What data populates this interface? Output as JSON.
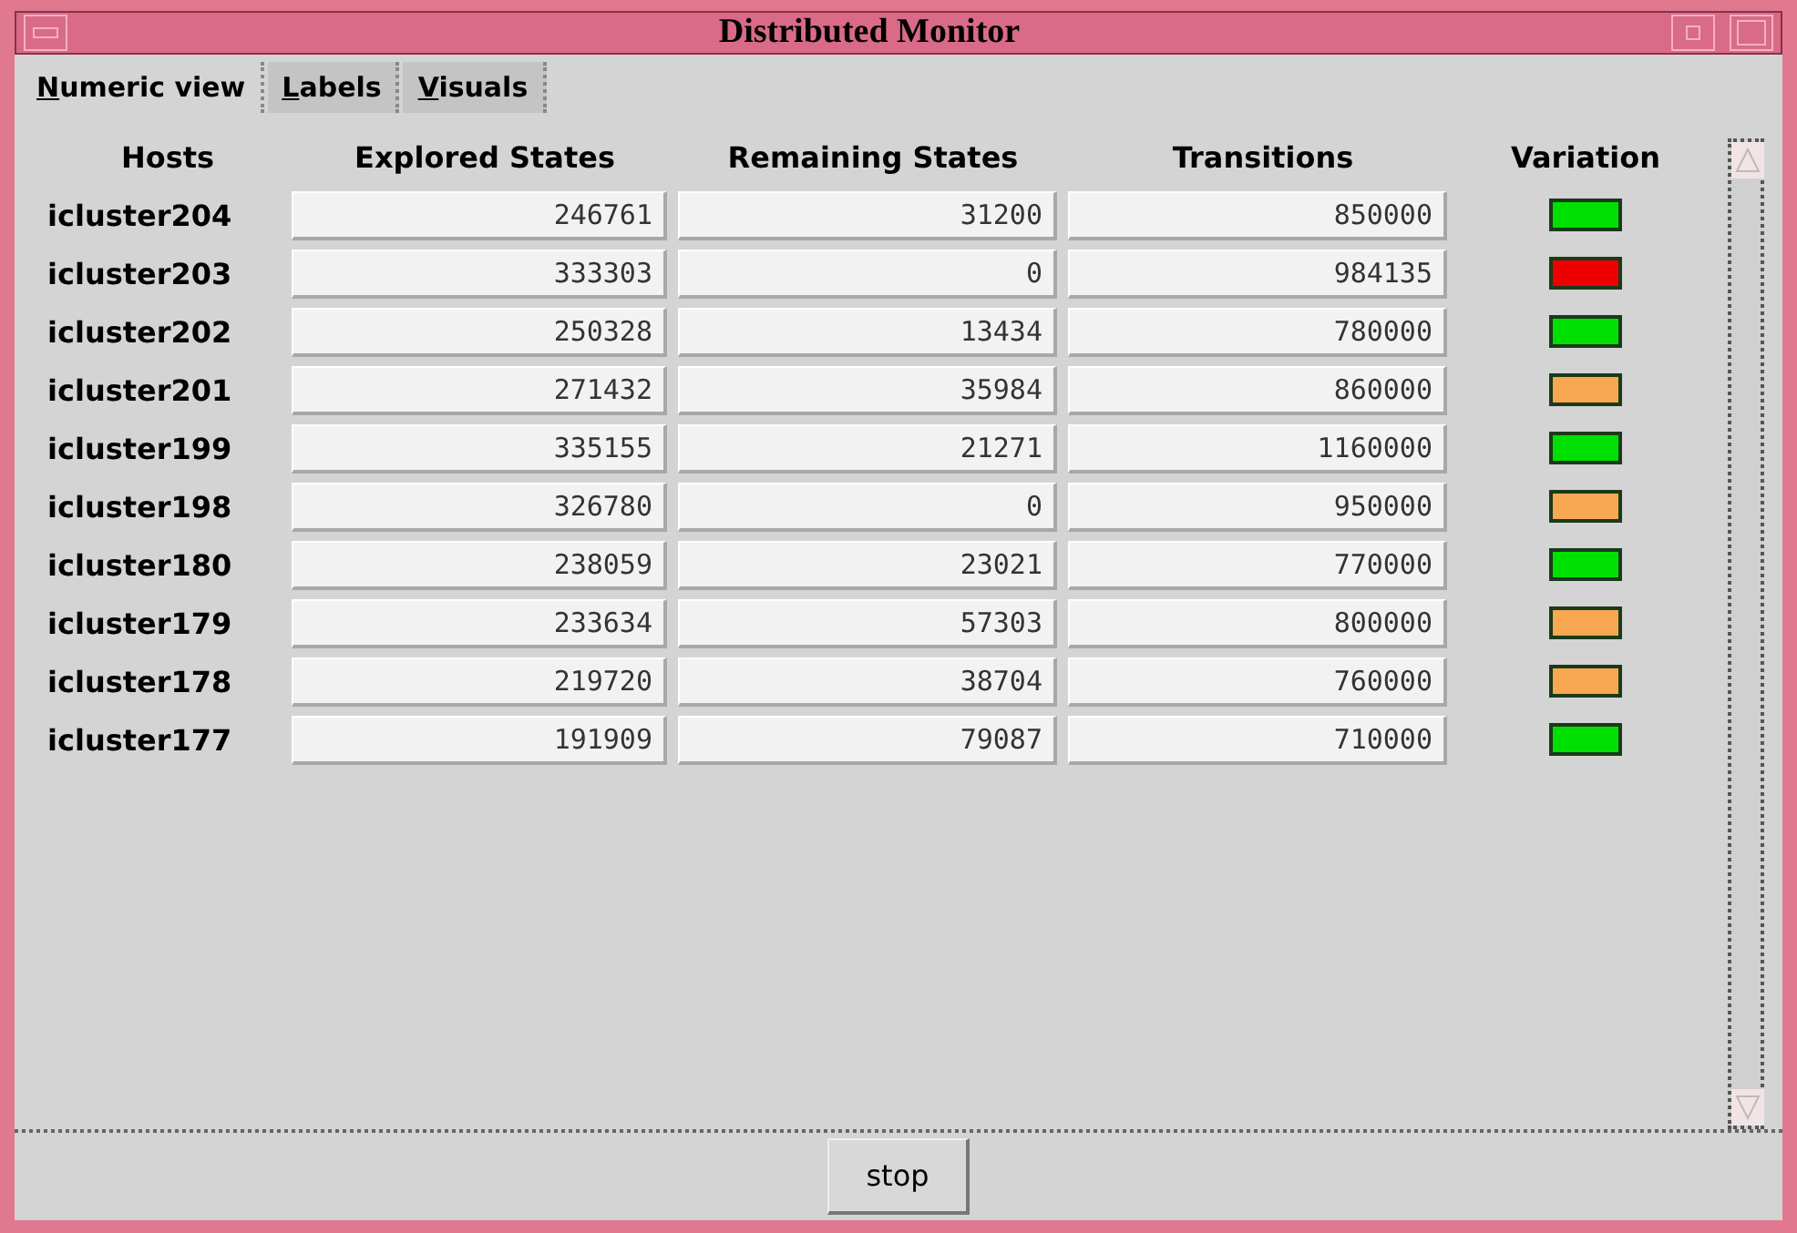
{
  "window": {
    "title": "Distributed Monitor"
  },
  "tabs": [
    {
      "label": "Numeric view",
      "selected": true
    },
    {
      "label": "Labels",
      "selected": false
    },
    {
      "label": "Visuals",
      "selected": false
    }
  ],
  "table": {
    "columns": [
      "Hosts",
      "Explored States",
      "Remaining States",
      "Transitions",
      "Variation"
    ],
    "rows": [
      {
        "host": "icluster204",
        "explored": "246761",
        "remaining": "31200",
        "transitions": "850000",
        "color": "#00e000"
      },
      {
        "host": "icluster203",
        "explored": "333303",
        "remaining": "0",
        "transitions": "984135",
        "color": "#ee0000"
      },
      {
        "host": "icluster202",
        "explored": "250328",
        "remaining": "13434",
        "transitions": "780000",
        "color": "#00e000"
      },
      {
        "host": "icluster201",
        "explored": "271432",
        "remaining": "35984",
        "transitions": "860000",
        "color": "#f8a850"
      },
      {
        "host": "icluster199",
        "explored": "335155",
        "remaining": "21271",
        "transitions": "1160000",
        "color": "#00e000"
      },
      {
        "host": "icluster198",
        "explored": "326780",
        "remaining": "0",
        "transitions": "950000",
        "color": "#f8a850"
      },
      {
        "host": "icluster180",
        "explored": "238059",
        "remaining": "23021",
        "transitions": "770000",
        "color": "#00e000"
      },
      {
        "host": "icluster179",
        "explored": "233634",
        "remaining": "57303",
        "transitions": "800000",
        "color": "#f8a850"
      },
      {
        "host": "icluster178",
        "explored": "219720",
        "remaining": "38704",
        "transitions": "760000",
        "color": "#f8a850"
      },
      {
        "host": "icluster177",
        "explored": "191909",
        "remaining": "79087",
        "transitions": "710000",
        "color": "#00e000"
      }
    ]
  },
  "buttons": [
    {
      "label": "stop"
    }
  ]
}
